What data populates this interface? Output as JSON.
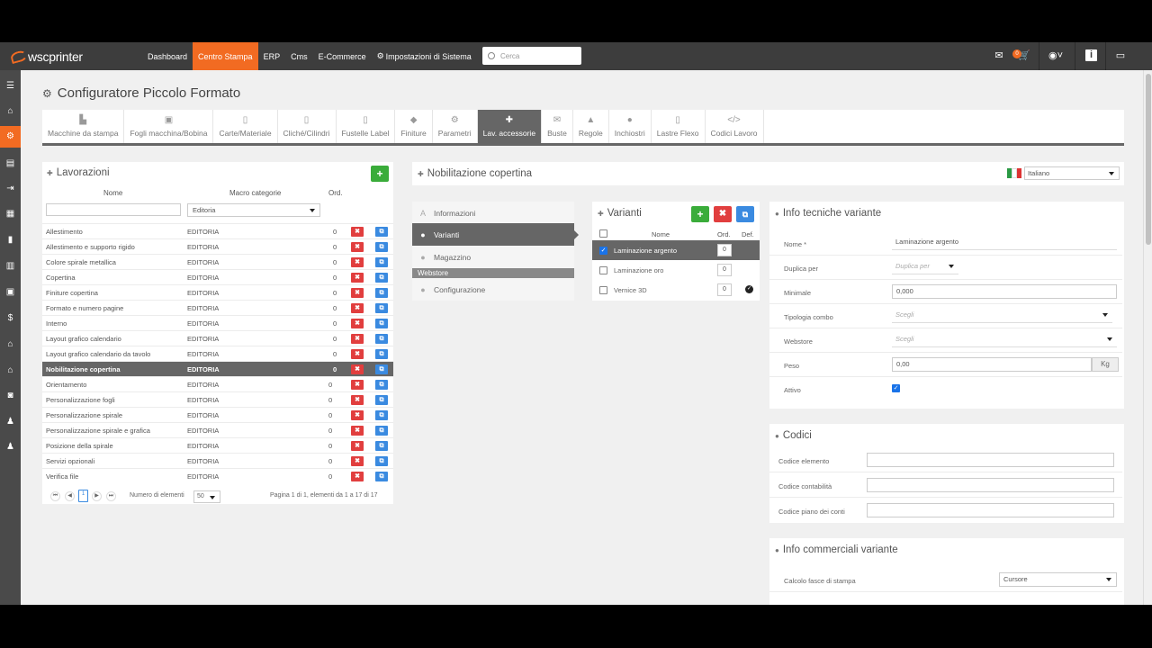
{
  "app": {
    "logo_text": "wscprinter",
    "nav": [
      "Dashboard",
      "Centro Stampa",
      "ERP",
      "Cms",
      "E-Commerce",
      "Impostazioni di Sistema"
    ],
    "search_placeholder": "Cerca",
    "notif_count": "0"
  },
  "page": {
    "title": "Configuratore Piccolo Formato"
  },
  "tabs": [
    {
      "label": "Macchine da stampa",
      "icon": "printer-icon"
    },
    {
      "label": "Fogli macchina/Bobina",
      "icon": "sheet-icon"
    },
    {
      "label": "Carte/Materiale",
      "icon": "paper-icon"
    },
    {
      "label": "Cliché/Cilindri",
      "icon": "cliche-icon"
    },
    {
      "label": "Fustelle Label",
      "icon": "die-icon"
    },
    {
      "label": "Finiture",
      "icon": "finish-icon"
    },
    {
      "label": "Parametri",
      "icon": "gear-icon"
    },
    {
      "label": "Lav. accessorie",
      "icon": "puzzle-icon"
    },
    {
      "label": "Buste",
      "icon": "envelope-icon"
    },
    {
      "label": "Regole",
      "icon": "lock-icon"
    },
    {
      "label": "Inchiostri",
      "icon": "ink-icon"
    },
    {
      "label": "Lastre Flexo",
      "icon": "plate-icon"
    },
    {
      "label": "Codici Lavoro",
      "icon": "code-icon"
    }
  ],
  "lavorazioni": {
    "title": "Lavorazioni",
    "col_nome": "Nome",
    "col_macro": "Macro categorie",
    "col_ord": "Ord.",
    "filter_select": "Editoria",
    "rows": [
      {
        "nome": "Allestimento",
        "macro": "EDITORIA",
        "ord": "0"
      },
      {
        "nome": "Allestimento e supporto rigido",
        "macro": "EDITORIA",
        "ord": "0"
      },
      {
        "nome": "Colore spirale metallica",
        "macro": "EDITORIA",
        "ord": "0"
      },
      {
        "nome": "Copertina",
        "macro": "EDITORIA",
        "ord": "0"
      },
      {
        "nome": "Finiture copertina",
        "macro": "EDITORIA",
        "ord": "0"
      },
      {
        "nome": "Formato e numero pagine",
        "macro": "EDITORIA",
        "ord": "0"
      },
      {
        "nome": "Interno",
        "macro": "EDITORIA",
        "ord": "0"
      },
      {
        "nome": "Layout grafico calendario",
        "macro": "EDITORIA",
        "ord": "0"
      },
      {
        "nome": "Layout grafico calendario da tavolo",
        "macro": "EDITORIA",
        "ord": "0"
      },
      {
        "nome": "Nobilitazione copertina",
        "macro": "EDITORIA",
        "ord": "0"
      },
      {
        "nome": "Orientamento",
        "macro": "EDITORIA",
        "ord": "0"
      },
      {
        "nome": "Personalizzazione fogli",
        "macro": "EDITORIA",
        "ord": "0"
      },
      {
        "nome": "Personalizzazione spirale",
        "macro": "EDITORIA",
        "ord": "0"
      },
      {
        "nome": "Personalizzazione spirale e grafica",
        "macro": "EDITORIA",
        "ord": "0"
      },
      {
        "nome": "Posizione della spirale",
        "macro": "EDITORIA",
        "ord": "0"
      },
      {
        "nome": "Servizi opzionali",
        "macro": "EDITORIA",
        "ord": "0"
      },
      {
        "nome": "Verifica file",
        "macro": "EDITORIA",
        "ord": "0"
      }
    ],
    "pager_current": "1",
    "pager_label": "Numero di elementi",
    "pager_size": "50",
    "pager_info": "Pagina 1 di 1, elementi da 1 a 17 di 17"
  },
  "nobilitazione": {
    "title": "Nobilitazione copertina",
    "language": "Italiano",
    "menu": [
      {
        "label": "Informazioni",
        "icon": "A"
      },
      {
        "label": "Varianti",
        "icon": "i"
      },
      {
        "label": "Magazzino",
        "icon": "i"
      }
    ],
    "webstore_section": "Webstore",
    "webstore_item": "Configurazione"
  },
  "varianti": {
    "title": "Varianti",
    "col_nome": "Nome",
    "col_ord": "Ord.",
    "col_def": "Def.",
    "rows": [
      {
        "nome": "Laminazione argento",
        "ord": "0"
      },
      {
        "nome": "Laminazione oro",
        "ord": "0"
      },
      {
        "nome": "Vernice 3D",
        "ord": "0"
      }
    ]
  },
  "info_tecniche": {
    "title": "Info tecniche variante",
    "nome_label": "Nome *",
    "nome_value": "Laminazione argento",
    "duplica_label": "Duplica per",
    "duplica_placeholder": "Duplica per",
    "minimale_label": "Minimale",
    "minimale_value": "0,000",
    "tipologia_label": "Tipologia combo",
    "tipologia_placeholder": "Scegli",
    "webstore_label": "Webstore",
    "webstore_placeholder": "Scegli",
    "peso_label": "Peso",
    "peso_value": "0,00",
    "peso_unit": "Kg",
    "attivo_label": "Attivo"
  },
  "codici": {
    "title": "Codici",
    "codice_elemento": "Codice elemento",
    "codice_contabilita": "Codice contabilità",
    "codice_piano": "Codice piano dei conti"
  },
  "info_commerciali": {
    "title": "Info commerciali variante",
    "calcolo_label": "Calcolo fasce di stampa",
    "calcolo_value": "Cursore"
  }
}
